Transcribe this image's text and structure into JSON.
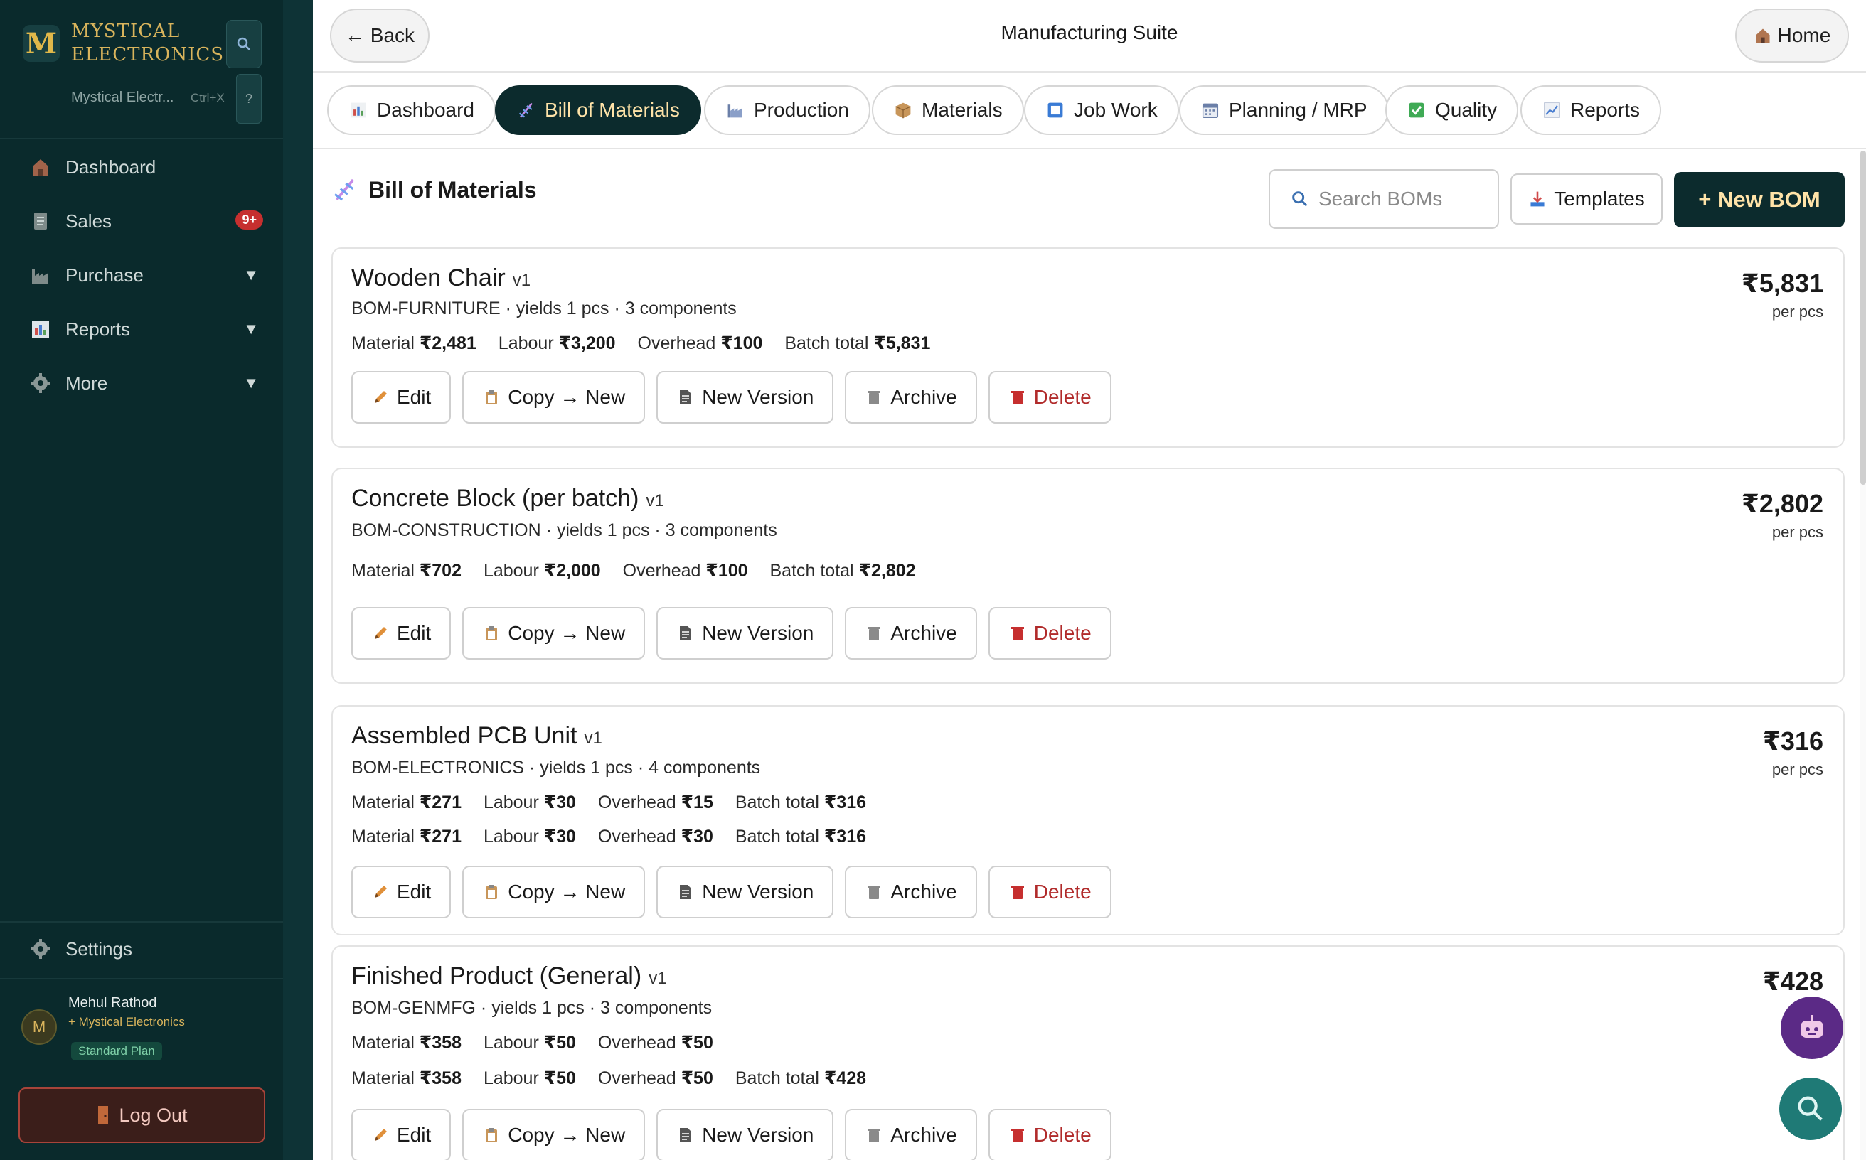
{
  "sidebar": {
    "brand_letter": "M",
    "brand_line1": "MYSTICAL",
    "brand_line2": "ELECTRONICS",
    "org_name": "Mystical Electr...",
    "shortcut": "Ctrl+X",
    "help": "?",
    "items": [
      {
        "label": "Dashboard",
        "icon": "house-icon"
      },
      {
        "label": "Sales",
        "icon": "document-icon",
        "badge": "9+"
      },
      {
        "label": "Purchase",
        "icon": "factory-icon",
        "caret": "▼"
      },
      {
        "label": "Reports",
        "icon": "bar-chart-icon",
        "caret": "▼"
      },
      {
        "label": "More",
        "icon": "gear-icon",
        "caret": "▼"
      }
    ],
    "settings_label": "Settings",
    "user": {
      "initial": "M",
      "name": "Mehul Rathod",
      "org": "+ Mystical Electronics",
      "plan": "Standard Plan"
    },
    "logout_label": "Log Out"
  },
  "topbar": {
    "back_label": "← Back",
    "title": "Manufacturing Suite",
    "home_label": "Home"
  },
  "tabs": [
    {
      "label": "Dashboard",
      "icon": "bar-chart-icon"
    },
    {
      "label": "Bill of Materials",
      "icon": "dna-icon",
      "active": true
    },
    {
      "label": "Production",
      "icon": "factory-icon"
    },
    {
      "label": "Materials",
      "icon": "package-icon"
    },
    {
      "label": "Job Work",
      "icon": "square-icon"
    },
    {
      "label": "Planning / MRP",
      "icon": "calendar-icon"
    },
    {
      "label": "Quality",
      "icon": "check-icon"
    },
    {
      "label": "Reports",
      "icon": "trend-chart-icon"
    }
  ],
  "page": {
    "title": "Bill of Materials",
    "search_placeholder": "Search BOMs",
    "templates_label": "Templates",
    "new_label": "+ New BOM"
  },
  "actions": {
    "edit": "Edit",
    "copy": "Copy → New",
    "new_version": "New Version",
    "archive": "Archive",
    "delete": "Delete"
  },
  "boms": [
    {
      "name": "Wooden Chair",
      "version": "v1",
      "meta": "BOM-FURNITURE · yields 1 pcs · 3 components",
      "cost_lines": [
        {
          "material": "₹2,481",
          "labour": "₹3,200",
          "overhead": "₹100",
          "batch_total": "₹5,831"
        }
      ],
      "price": "₹5,831",
      "per": "per pcs"
    },
    {
      "name": "Concrete Block (per batch)",
      "version": "v1",
      "meta": "BOM-CONSTRUCTION · yields 1 pcs · 3 components",
      "cost_lines": [
        {
          "material": "₹702",
          "labour": "₹2,000",
          "overhead": "₹100",
          "batch_total": "₹2,802"
        }
      ],
      "price": "₹2,802",
      "per": "per pcs"
    },
    {
      "name": "Assembled PCB Unit",
      "version": "v1",
      "meta": "BOM-ELECTRONICS · yields 1 pcs · 4 components",
      "cost_lines": [
        {
          "material": "₹271",
          "labour": "₹30",
          "overhead": "₹15",
          "batch_total": "₹316"
        },
        {
          "material": "₹271",
          "labour": "₹30",
          "overhead": "₹30",
          "batch_total": "₹316"
        }
      ],
      "price": "₹316",
      "per": "per pcs"
    },
    {
      "name": "Finished Product (General)",
      "version": "v1",
      "meta": "BOM-GENMFG · yields 1 pcs · 3 components",
      "cost_lines": [
        {
          "material": "₹358",
          "labour": "₹50",
          "overhead": "₹50",
          "batch_total": ""
        },
        {
          "material": "₹358",
          "labour": "₹50",
          "overhead": "₹50",
          "batch_total": "₹428"
        }
      ],
      "price": "₹428",
      "per": "pe"
    }
  ],
  "labels": {
    "material": "Material",
    "labour": "Labour",
    "overhead": "Overhead",
    "batch_total": "Batch total"
  }
}
